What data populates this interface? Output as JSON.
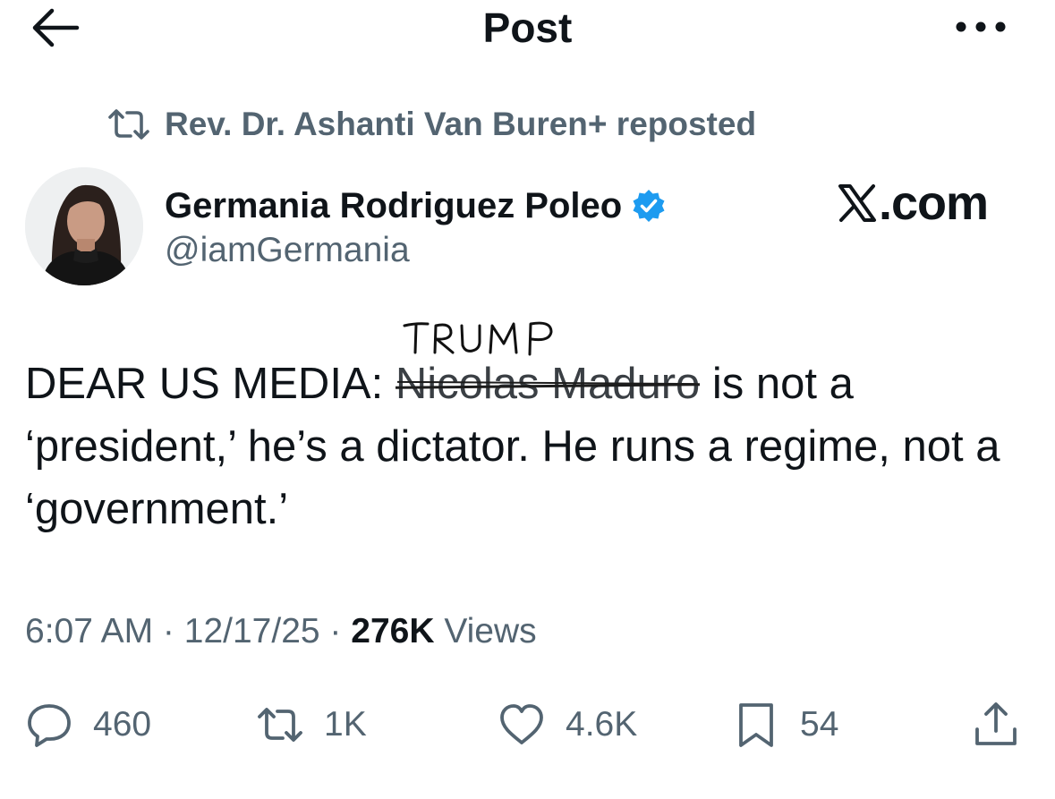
{
  "header": {
    "title": "Post",
    "back_icon": "arrow-left-icon",
    "more_icon": "more-horizontal-icon"
  },
  "repost": {
    "text": "Rev. Dr. Ashanti Van Buren+ reposted",
    "icon": "repost-icon"
  },
  "author": {
    "name": "Germania Rodriguez Poleo",
    "handle": "@iamGermania",
    "verified_icon": "verified-badge-icon",
    "verified_color": "#1d9bf0"
  },
  "watermark": {
    "text": ".com"
  },
  "annotation": {
    "handwritten_text": "TRUMP"
  },
  "post": {
    "text_before": "DEAR US MEDIA: ",
    "struck_text": "Nicolas Maduro",
    "text_after": " is not a ‘president,’ he’s a dictator. He runs a regime, not a ‘government.’"
  },
  "meta": {
    "time": "6:07 AM",
    "sep1": " · ",
    "date": "12/17/25",
    "sep2": " · ",
    "views_count": "276K",
    "views_label": " Views"
  },
  "actions": {
    "replies": "460",
    "reposts": "1K",
    "likes": "4.6K",
    "bookmarks": "54"
  },
  "colors": {
    "text_primary": "#0f1419",
    "text_secondary": "#536471",
    "background": "#ffffff"
  }
}
